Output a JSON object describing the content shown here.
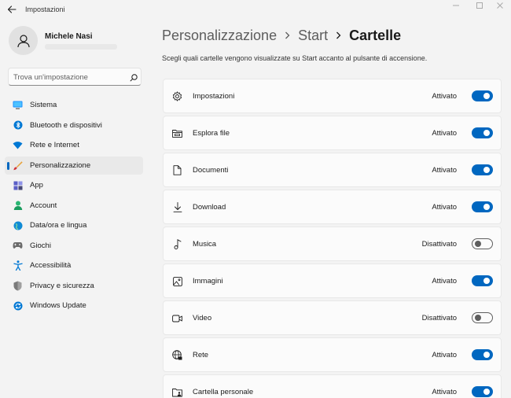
{
  "window": {
    "title": "Impostazioni"
  },
  "profile": {
    "name": "Michele Nasi"
  },
  "search": {
    "placeholder": "Trova un'impostazione"
  },
  "sidebar": {
    "items": [
      {
        "label": "Sistema",
        "icon": "monitor-icon",
        "selected": false
      },
      {
        "label": "Bluetooth e dispositivi",
        "icon": "bluetooth-icon",
        "selected": false
      },
      {
        "label": "Rete e Internet",
        "icon": "wifi-icon",
        "selected": false
      },
      {
        "label": "Personalizzazione",
        "icon": "brush-icon",
        "selected": true
      },
      {
        "label": "App",
        "icon": "apps-icon",
        "selected": false
      },
      {
        "label": "Account",
        "icon": "account-icon",
        "selected": false
      },
      {
        "label": "Data/ora e lingua",
        "icon": "globe-clock-icon",
        "selected": false
      },
      {
        "label": "Giochi",
        "icon": "gamepad-icon",
        "selected": false
      },
      {
        "label": "Accessibilità",
        "icon": "accessibility-icon",
        "selected": false
      },
      {
        "label": "Privacy e sicurezza",
        "icon": "shield-icon",
        "selected": false
      },
      {
        "label": "Windows Update",
        "icon": "update-icon",
        "selected": false
      }
    ]
  },
  "breadcrumb": {
    "items": [
      "Personalizzazione",
      "Start"
    ],
    "current": "Cartelle"
  },
  "main": {
    "description": "Scegli quali cartelle vengono visualizzate su Start accanto al pulsante di accensione.",
    "folders": [
      {
        "label": "Impostazioni",
        "status": "Attivato",
        "on": true,
        "icon": "gear-icon"
      },
      {
        "label": "Esplora file",
        "status": "Attivato",
        "on": true,
        "icon": "folder-icon"
      },
      {
        "label": "Documenti",
        "status": "Attivato",
        "on": true,
        "icon": "document-icon"
      },
      {
        "label": "Download",
        "status": "Attivato",
        "on": true,
        "icon": "download-icon"
      },
      {
        "label": "Musica",
        "status": "Disattivato",
        "on": false,
        "icon": "music-icon"
      },
      {
        "label": "Immagini",
        "status": "Attivato",
        "on": true,
        "icon": "image-icon"
      },
      {
        "label": "Video",
        "status": "Disattivato",
        "on": false,
        "icon": "video-icon"
      },
      {
        "label": "Rete",
        "status": "Attivato",
        "on": true,
        "icon": "network-icon"
      },
      {
        "label": "Cartella personale",
        "status": "Attivato",
        "on": true,
        "icon": "personal-folder-icon"
      }
    ]
  },
  "colors": {
    "accent": "#0067c0",
    "background": "#f3f3f3",
    "card": "#fbfbfb"
  }
}
